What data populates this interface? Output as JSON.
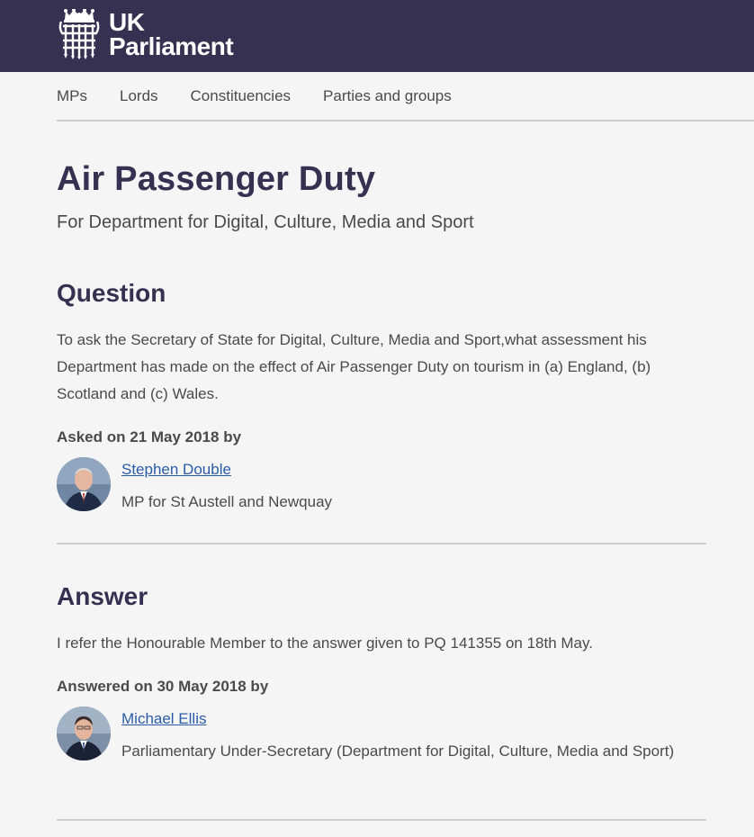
{
  "header": {
    "logo_line1": "UK",
    "logo_line2": "Parliament",
    "brand_color": "#373151"
  },
  "nav": {
    "items": [
      "MPs",
      "Lords",
      "Constituencies",
      "Parties and groups"
    ]
  },
  "page": {
    "title": "Air Passenger Duty",
    "subtitle": "For Department for Digital, Culture, Media and Sport"
  },
  "question": {
    "heading": "Question",
    "text": "To ask the Secretary of State for Digital, Culture, Media and Sport,what assessment his Department has made on the effect of Air Passenger Duty on tourism in (a) England, (b) Scotland and (c) Wales.",
    "asked_label": "Asked on 21 May 2018 by",
    "member_name": "Stephen Double",
    "member_role": "MP for St Austell and Newquay"
  },
  "answer": {
    "heading": "Answer",
    "text": "I refer the Honourable Member to the answer given to PQ 141355 on 18th May.",
    "answered_label": "Answered on 30 May 2018 by",
    "member_name": "Michael Ellis",
    "member_role": "Parliamentary Under-Secretary (Department for Digital, Culture, Media and Sport)"
  }
}
